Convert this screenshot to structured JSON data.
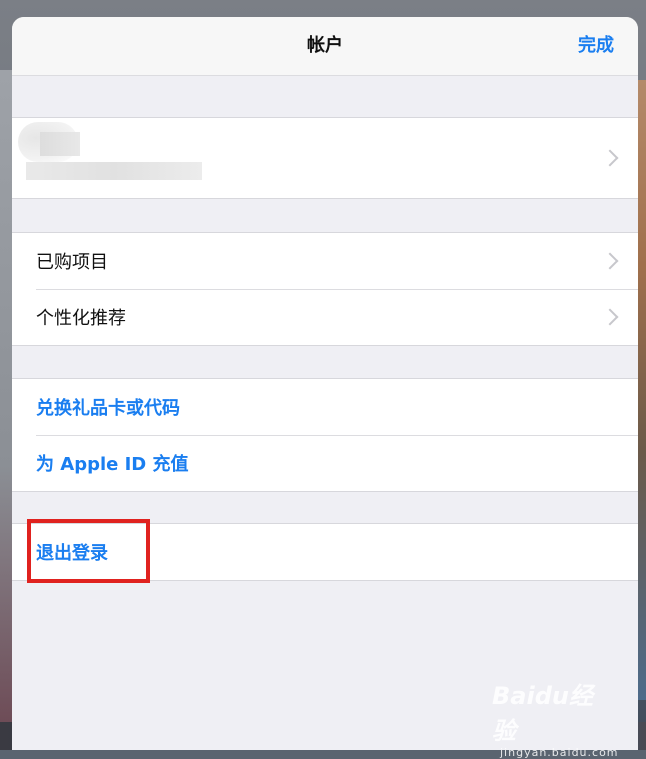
{
  "navbar": {
    "title": "帐户",
    "done_label": "完成"
  },
  "purchases": {
    "items": [
      {
        "label": "已购项目"
      },
      {
        "label": "个性化推荐"
      }
    ]
  },
  "funds": {
    "items": [
      {
        "label": "兑换礼品卡或代码"
      },
      {
        "label": "为 Apple ID 充值"
      }
    ]
  },
  "signout": {
    "label": "退出登录"
  },
  "colors": {
    "accent": "#1a7ef0",
    "annotation": "#e0221f",
    "sheet_bg": "#efeff4"
  },
  "watermark": {
    "logo": "Baidu经验",
    "sub": "jingyan.baidu.com"
  }
}
